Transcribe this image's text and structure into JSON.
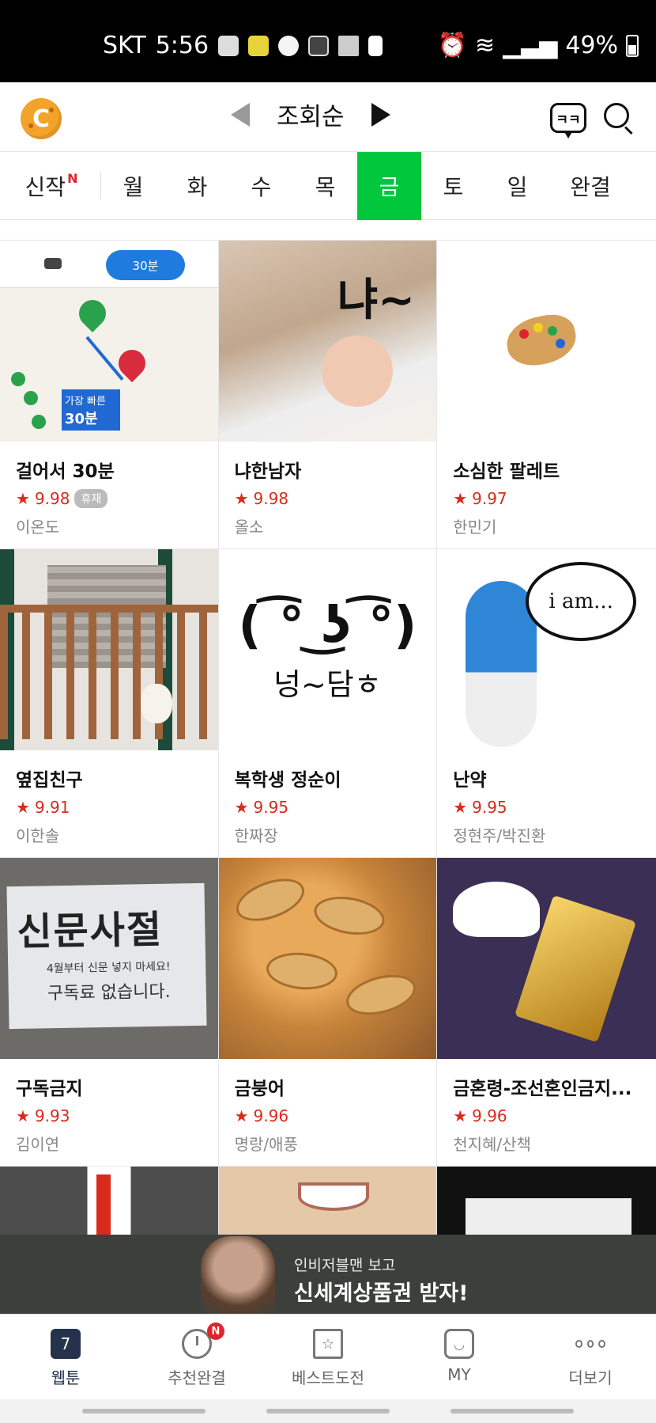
{
  "status_bar": {
    "carrier": "SKT",
    "time": "5:56",
    "battery": "49%",
    "icons": [
      "image-icon",
      "app-icon",
      "app-icon",
      "play-icon",
      "cleaner-icon",
      "sim-icon",
      "alarm-icon",
      "wifi-icon",
      "signal-icon",
      "battery-icon"
    ]
  },
  "header": {
    "logo_text": "C",
    "sort_label": "조회순",
    "chat_label": "ㅋㅋ"
  },
  "day_tabs": {
    "new_label": "신작",
    "new_badge": "N",
    "days": [
      "월",
      "화",
      "수",
      "목",
      "금",
      "토",
      "일"
    ],
    "active": "금",
    "completed": "완결"
  },
  "accent_color": "#00c73c",
  "webtoons": [
    {
      "title": "걸어서 30분",
      "rating": "9.98",
      "badge": "휴재",
      "author": "이온도",
      "thumb_text": {
        "pill": "30분",
        "box_top": "가장 빠른",
        "box_bottom": "30분"
      }
    },
    {
      "title": "냐한남자",
      "rating": "9.98",
      "author": "올소",
      "thumb_text": {
        "caption": "냐~"
      }
    },
    {
      "title": "소심한 팔레트",
      "rating": "9.97",
      "author": "한민기"
    },
    {
      "title": "옆집친구",
      "rating": "9.91",
      "author": "이한솔"
    },
    {
      "title": "복학생 정순이",
      "rating": "9.95",
      "author": "한짜장",
      "thumb_text": {
        "face": "( ͡° ͜ʖ ͡°)",
        "caption": "넝~담ㅎ"
      }
    },
    {
      "title": "난약",
      "rating": "9.95",
      "author": "정현주/박진환",
      "thumb_text": {
        "bubble": "i am..."
      }
    },
    {
      "title": "구독금지",
      "rating": "9.93",
      "author": "김이연",
      "thumb_text": {
        "big": "신문사절",
        "line1": "4월부터 신문 넣지 마세요!",
        "line2": "구독료 없습니다."
      }
    },
    {
      "title": "금붕어",
      "rating": "9.96",
      "author": "명랑/애풍"
    },
    {
      "title": "금혼령-조선혼인금지...",
      "rating": "9.96",
      "author": "천지혜/산책"
    }
  ],
  "ad": {
    "line1": "인비저블맨 보고",
    "line2": "신세계상품권 받자!"
  },
  "bottom_nav": [
    {
      "label": "웹툰",
      "icon": "calendar-icon",
      "badge_number": "7"
    },
    {
      "label": "추천완결",
      "icon": "timer-icon",
      "badge": "N"
    },
    {
      "label": "베스트도전",
      "icon": "star-book-icon"
    },
    {
      "label": "MY",
      "icon": "face-icon"
    },
    {
      "label": "더보기",
      "icon": "more-icon"
    }
  ]
}
